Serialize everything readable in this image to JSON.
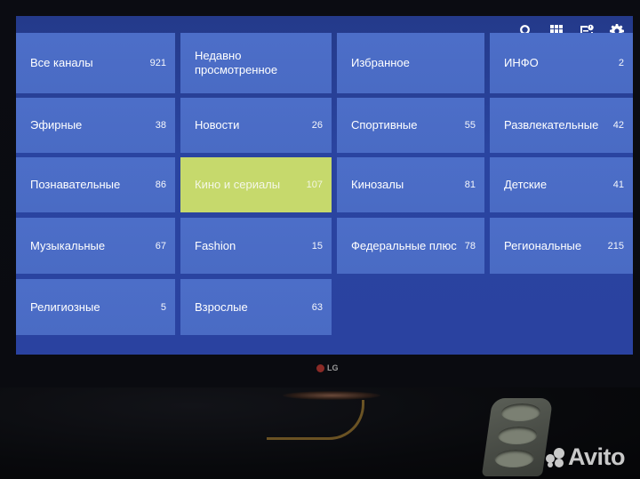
{
  "toolbar": {
    "buttons": [
      {
        "icon": "search-icon",
        "label": "Поиск"
      },
      {
        "icon": "grid-icon",
        "label": "Вид"
      },
      {
        "icon": "epg-icon",
        "label": "Программа"
      },
      {
        "icon": "gear-icon",
        "label": "Настройки"
      }
    ]
  },
  "categories": [
    {
      "name": "Все каналы",
      "count": "921"
    },
    {
      "name": "Недавно просмотренное",
      "count": ""
    },
    {
      "name": "Избранное",
      "count": ""
    },
    {
      "name": "ИНФО",
      "count": "2"
    },
    {
      "name": "Эфирные",
      "count": "38"
    },
    {
      "name": "Новости",
      "count": "26"
    },
    {
      "name": "Спортивные",
      "count": "55"
    },
    {
      "name": "Развлекательные",
      "count": "42"
    },
    {
      "name": "Познавательные",
      "count": "86"
    },
    {
      "name": "Кино и сериалы",
      "count": "107",
      "selected": true
    },
    {
      "name": "Кинозалы",
      "count": "81"
    },
    {
      "name": "Детские",
      "count": "41"
    },
    {
      "name": "Музыкальные",
      "count": "67"
    },
    {
      "name": "Fashion",
      "count": "15"
    },
    {
      "name": "Федеральные плюс",
      "count": "78"
    },
    {
      "name": "Региональные",
      "count": "215"
    },
    {
      "name": "Религиозные",
      "count": "5"
    },
    {
      "name": "Взрослые",
      "count": "63"
    }
  ],
  "colors": {
    "background": "#2a42a0",
    "tile": "#4c6ec8",
    "selected_tile": "#c6d96c",
    "text": "#ffffff"
  },
  "photo": {
    "tv_brand": "LG",
    "watermark": "Avito"
  }
}
